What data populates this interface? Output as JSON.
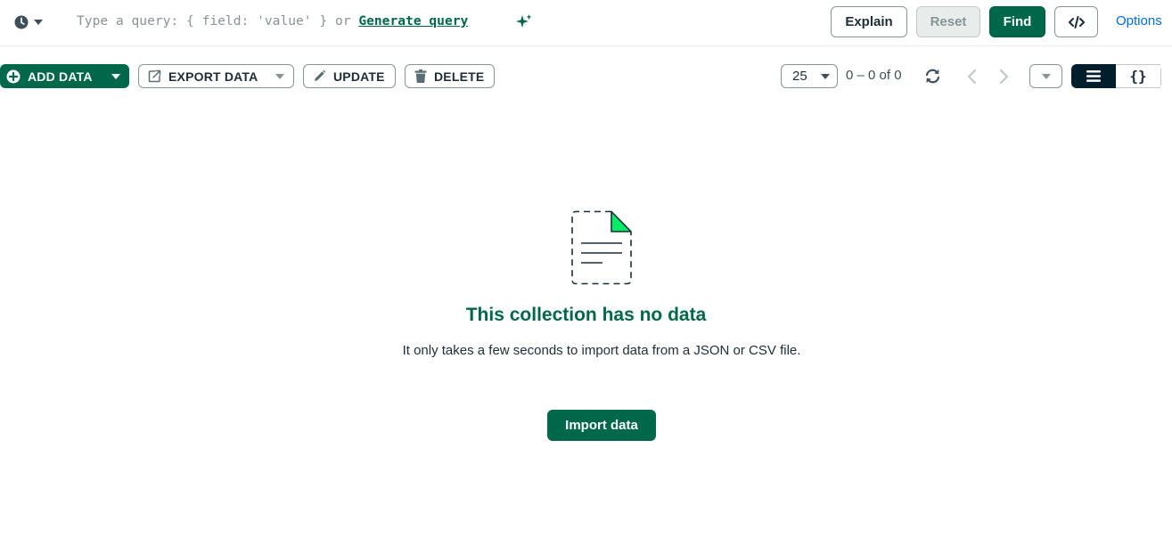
{
  "query_bar": {
    "history_icon": "clock-icon",
    "placeholder_prefix": "Type a query: { field: 'value' } or ",
    "generate_query_label": "Generate query",
    "sparkle_icon": "sparkle-icon",
    "explain_label": "Explain",
    "reset_label": "Reset",
    "find_label": "Find",
    "code_icon": "code-icon",
    "options_label": "Options"
  },
  "toolbar": {
    "add_data_label": "ADD DATA",
    "export_data_label": "EXPORT DATA",
    "update_label": "UPDATE",
    "delete_label": "DELETE",
    "page_size": "25",
    "range_text": "0 – 0 of 0",
    "view_list_icon": "list-view-icon",
    "view_json_icon": "{}"
  },
  "empty_state": {
    "title": "This collection has no data",
    "description": "It only takes a few seconds to import data from a JSON or CSV file.",
    "import_button_label": "Import data"
  },
  "colors": {
    "brand_green": "#00684a",
    "dark": "#001e2b",
    "link_blue": "#016bf8",
    "illustration_green": "#00ed64"
  }
}
